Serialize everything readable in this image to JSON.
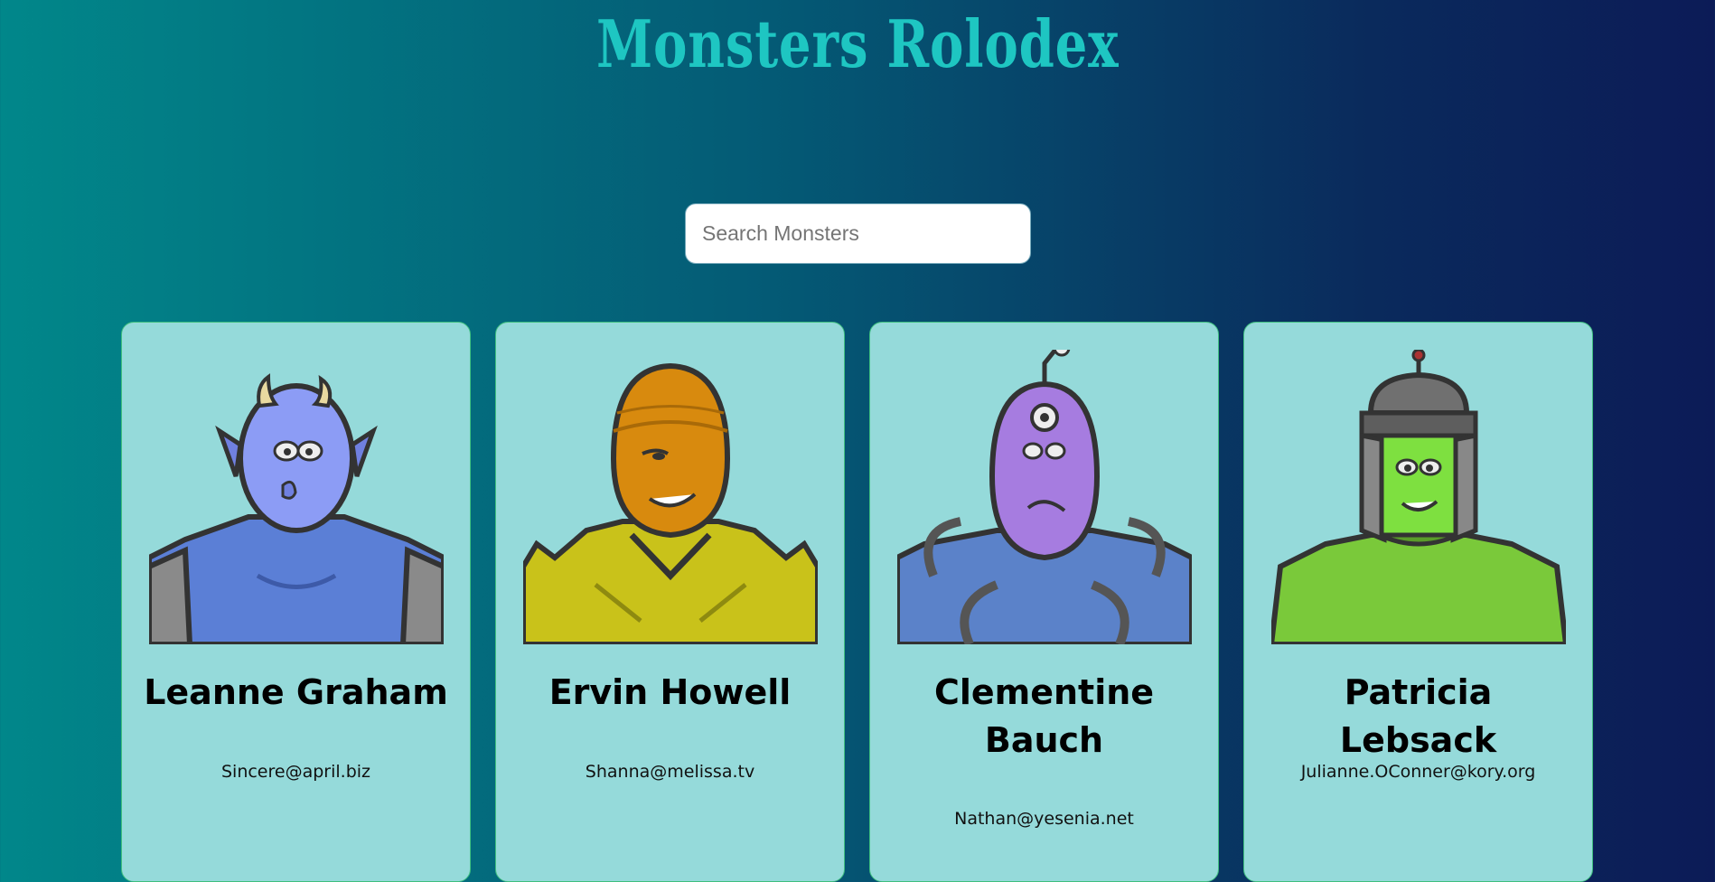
{
  "header": {
    "title": "Monsters Rolodex"
  },
  "search": {
    "placeholder": "Search Monsters",
    "value": ""
  },
  "monsters": [
    {
      "name": "Leanne Graham",
      "email": "Sincere@april.biz",
      "theme": "blue-horned"
    },
    {
      "name": "Ervin Howell",
      "email": "Shanna@melissa.tv",
      "theme": "orange-spiky"
    },
    {
      "name": "Clementine Bauch",
      "email": "Nathan@yesenia.net",
      "theme": "purple-cyclops"
    },
    {
      "name": "Patricia Lebsack",
      "email": "Julianne.OConner@kory.org",
      "theme": "green-helmet"
    }
  ],
  "colors": {
    "title": "#1ec6c2",
    "card_background": "#95dada",
    "card_border": "#3fbf7f"
  }
}
